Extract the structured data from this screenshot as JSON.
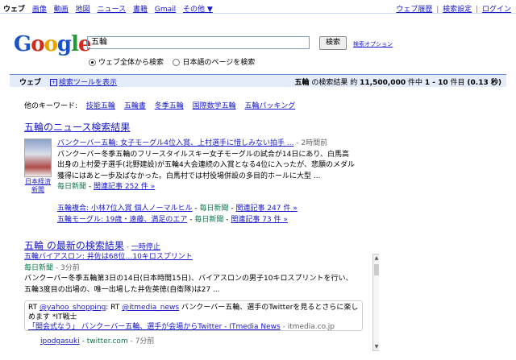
{
  "topnav": {
    "items": [
      "ウェブ",
      "画像",
      "動画",
      "地図",
      "ニュース",
      "書籍",
      "Gmail",
      "その他 ▼"
    ],
    "right": [
      "ウェブ履歴",
      "検索設定",
      "ログイン"
    ],
    "separator": "|"
  },
  "logo": "Google",
  "search": {
    "query": "五輪",
    "button": "検索",
    "options_link": "検索オプション"
  },
  "radios": {
    "all_web": "ウェブ全体から検索",
    "japanese": "日本語のページを検索"
  },
  "bar": {
    "web": "ウェブ",
    "tools": "検索ツールを表示",
    "stats_query": "五輪",
    "stats_mid": "の検索結果 約",
    "stats_total": "11,500,000",
    "stats_mid2": "件中",
    "stats_range": "1 - 10",
    "stats_end": "件目",
    "stats_time": "(0.13 秒)"
  },
  "related": {
    "label": "他のキーワード:",
    "items": [
      "技能五輪",
      "五輪書",
      "冬季五輪",
      "国際数学五輪",
      "五輪パッキング"
    ]
  },
  "news": {
    "title": "五輪のニュース検索結果",
    "thumb_caption": "日本経済新聞",
    "headline": "バンクーバー五輪: 女子モーグル4位入賞、上村選手に惜しみない拍手 ...",
    "headline_time": "- 2時間前",
    "snippet": "バンクーバー冬季五輪のフリースタイルスキー女子モーグルの試合が14日にあり、白馬高出身の上村愛子選手(北野建設)が五輪4大会連続の入賞となる4位に入ったが、悲願のメダル獲得にはあと一歩及ばなかった。白馬村では村役場併設の多目的ホールに大型 ...",
    "source": "毎日新聞",
    "related_link": "関連記事 252 件 »",
    "more": [
      {
        "title": "五輪複合: 小林7位入賞 個人ノーマルヒル",
        "source": "毎日新聞",
        "link": "関連記事 247 件 »"
      },
      {
        "title": "五輪モーグル: 19歳・遠藤、満足のエア",
        "source": "毎日新聞",
        "link": "関連記事 73 件 »"
      }
    ]
  },
  "latest": {
    "title": "五輪 の最新の検索結果",
    "pause": "一時停止",
    "item_title": "五輪バイアスロン: 井佐は68位…10キロスプリント",
    "item_source": "毎日新聞",
    "item_time": "- 3分前",
    "item_snippet": "バンクーバー冬季五輪第3日の14日(日本時間15日)、バイアスロンの男子10キロスプリントを行い、五輪3度目の出場の、唯一出場した井佐英徳(自衛隊)は27 ...",
    "tweet_rt": "RT",
    "tweet_user1": "@yahoo_shopping",
    "tweet_rt2": ": RT",
    "tweet_user2": "@itmedia_news",
    "tweet_text": "バンクーバー五輪、選手のTwitterを見るとさらに楽しめます *IT戦士",
    "tweet_link": "「開会式なう」 バンクーバー五輪、選手が会場からTwitter - ITmedia News",
    "tweet_domain": "- itmedia.co.jp",
    "footer_user": "ipodgasuki",
    "footer_site": "- twitter.com",
    "footer_time": "- 7分前"
  }
}
